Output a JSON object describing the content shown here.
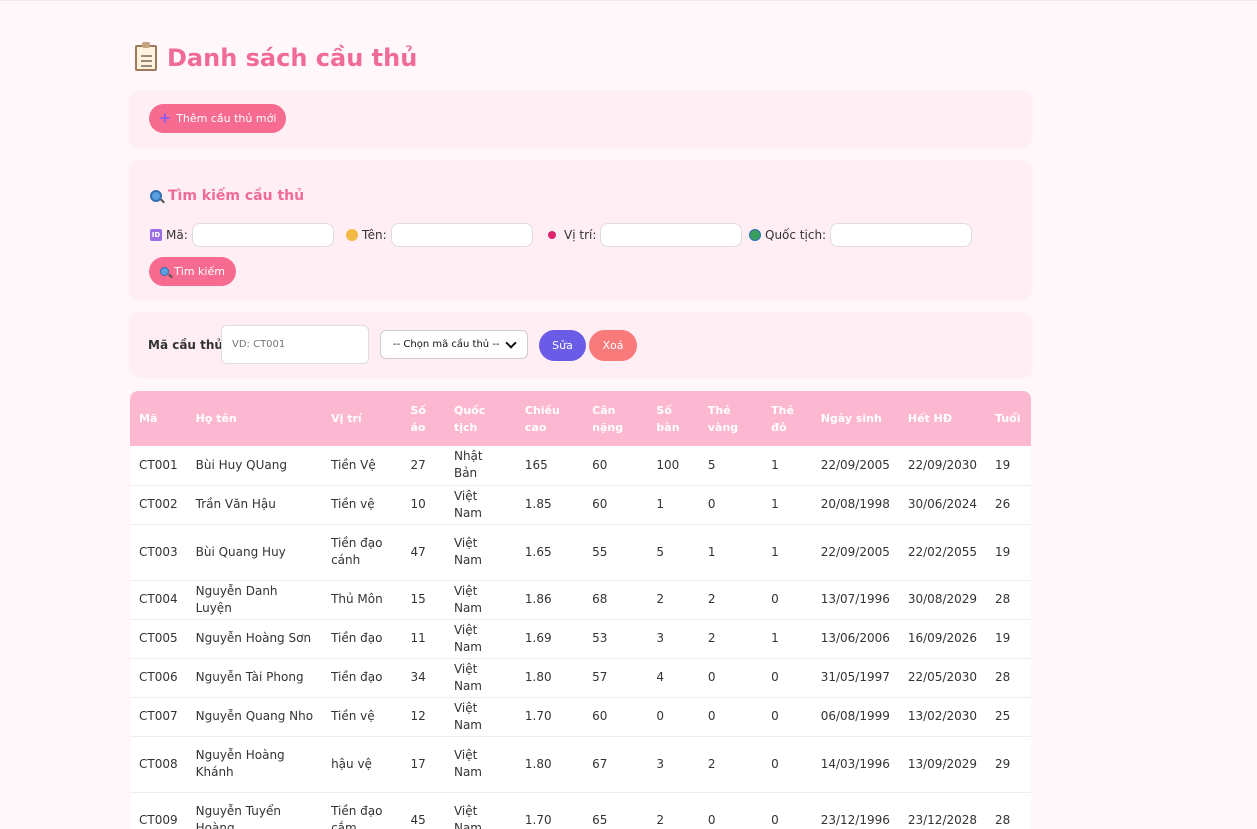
{
  "page": {
    "title": "Danh sách cầu thủ",
    "icon": "clipboard-icon"
  },
  "add": {
    "label": "Thêm cầu thủ mới",
    "icon": "plus-icon"
  },
  "search": {
    "title": "Tìm kiếm cầu thủ",
    "fields": {
      "ma": {
        "label": "Mã:",
        "icon": "id-icon",
        "value": ""
      },
      "ten": {
        "label": "Tên:",
        "icon": "face-icon",
        "value": ""
      },
      "vitri": {
        "label": "Vị trí:",
        "icon": "pin-icon",
        "value": ""
      },
      "quoctich": {
        "label": "Quốc tịch:",
        "icon": "globe-icon",
        "value": ""
      }
    },
    "button": "Tìm kiếm"
  },
  "edit": {
    "label": "Mã cầu thủ:",
    "placeholder": "VD: CT001",
    "select": "-- Chọn mã cầu thủ --",
    "edit_button": "Sửa",
    "delete_button": "Xoá"
  },
  "colors": {
    "accent": "#f06b96",
    "header": "#fbb8d0",
    "edit": "#6b5ce7",
    "delete": "#f87a7a"
  },
  "table": {
    "headers": [
      "Mã",
      "Họ tên",
      "Vị trí",
      "Số\náo",
      "Quốc\ntịch",
      "Chiều\ncao",
      "Cân\nnặng",
      "Số\nbàn",
      "Thẻ\nvàng",
      "Thẻ\nđỏ",
      "Ngày sinh",
      "Hết HĐ",
      "Tuổi"
    ],
    "rows": [
      [
        "CT001",
        "Bùi Huy QUang",
        "Tiền Vệ",
        "27",
        "Nhật Bản",
        "165",
        "60",
        "100",
        "5",
        "1",
        "22/09/2005",
        "22/09/2030",
        "19"
      ],
      [
        "CT002",
        "Trần Văn Hậu",
        "Tiền vệ",
        "10",
        "Việt Nam",
        "1.85",
        "60",
        "1",
        "0",
        "1",
        "20/08/1998",
        "30/06/2024",
        "26"
      ],
      [
        "CT003",
        "Bùi Quang Huy",
        "Tiền đạo\ncánh",
        "47",
        "Việt Nam",
        "1.65",
        "55",
        "5",
        "1",
        "1",
        "22/09/2005",
        "22/02/2055",
        "19"
      ],
      [
        "CT004",
        "Nguyễn Danh Luyện",
        "Thủ Môn",
        "15",
        "Việt Nam",
        "1.86",
        "68",
        "2",
        "2",
        "0",
        "13/07/1996",
        "30/08/2029",
        "28"
      ],
      [
        "CT005",
        "Nguyễn Hoàng Sơn",
        "Tiền đạo",
        "11",
        "Việt Nam",
        "1.69",
        "53",
        "3",
        "2",
        "1",
        "13/06/2006",
        "16/09/2026",
        "19"
      ],
      [
        "CT006",
        "Nguyễn Tài Phong",
        "Tiền đạo",
        "34",
        "Việt Nam",
        "1.80",
        "57",
        "4",
        "0",
        "0",
        "31/05/1997",
        "22/05/2030",
        "28"
      ],
      [
        "CT007",
        "Nguyễn Quang Nho",
        "Tiền vệ",
        "12",
        "Việt Nam",
        "1.70",
        "60",
        "0",
        "0",
        "0",
        "06/08/1999",
        "13/02/2030",
        "25"
      ],
      [
        "CT008",
        "Nguyễn Hoàng\nKhánh",
        "hậu vệ",
        "17",
        "Việt Nam",
        "1.80",
        "67",
        "3",
        "2",
        "0",
        "14/03/1996",
        "13/09/2029",
        "29"
      ],
      [
        "CT009",
        "Nguyễn Tuyển Hoàng",
        "Tiền đạo\ncắm",
        "45",
        "Việt Nam",
        "1.70",
        "65",
        "2",
        "0",
        "0",
        "23/12/1996",
        "23/12/2028",
        "28"
      ]
    ]
  }
}
